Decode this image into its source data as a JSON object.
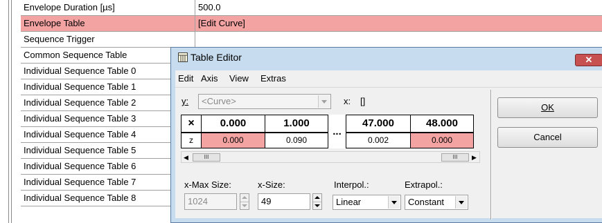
{
  "grid": {
    "rows": [
      {
        "name": "Envelope Duration [µs]",
        "value": "500.0",
        "highlighted": false
      },
      {
        "name": "Envelope Table",
        "value": "[Edit Curve]",
        "highlighted": true
      },
      {
        "name": "Sequence Trigger",
        "value": "",
        "highlighted": false
      },
      {
        "name": "Common Sequence Table",
        "value": "",
        "highlighted": false
      },
      {
        "name": "Individual Sequence Table 0",
        "value": "",
        "highlighted": false
      },
      {
        "name": "Individual Sequence Table 1",
        "value": "",
        "highlighted": false
      },
      {
        "name": "Individual Sequence Table 2",
        "value": "",
        "highlighted": false
      },
      {
        "name": "Individual Sequence Table 3",
        "value": "",
        "highlighted": false
      },
      {
        "name": "Individual Sequence Table 4",
        "value": "",
        "highlighted": false
      },
      {
        "name": "Individual Sequence Table 5",
        "value": "",
        "highlighted": false
      },
      {
        "name": "Individual Sequence Table 6",
        "value": "",
        "highlighted": false
      },
      {
        "name": "Individual Sequence Table 7",
        "value": "",
        "highlighted": false
      },
      {
        "name": "Individual Sequence Table 8",
        "value": "",
        "highlighted": false
      }
    ]
  },
  "dialog": {
    "title": "Table Editor",
    "close_glyph": "✕",
    "menu": [
      "Edit",
      "Axis",
      "View",
      "Extras"
    ],
    "y_label": "y:",
    "y_combo_value": "<Curve>",
    "x_label": "x:",
    "x_value_box": "[]",
    "table": {
      "corner": "×",
      "headers": [
        "0.000",
        "1.000",
        "...",
        "47.000",
        "48.000"
      ],
      "row_label": "z",
      "values": [
        "0.000",
        "0.090",
        "",
        "0.002",
        "0.000"
      ]
    },
    "scroll_thumb_left": "III",
    "scroll_thumb_right": "III",
    "fields": {
      "xmax_label": "x-Max Size:",
      "xmax_value": "1024",
      "xsize_label": "x-Size:",
      "xsize_value": "49",
      "interpol_label": "Interpol.:",
      "interpol_value": "Linear",
      "extrapol_label": "Extrapol.:",
      "extrapol_value": "Constant"
    },
    "ok_label": "OK",
    "cancel_label": "Cancel"
  },
  "colors": {
    "highlight": "#f4a3a3",
    "dialog_frame": "#c8dcef",
    "close_button": "#c75050"
  }
}
